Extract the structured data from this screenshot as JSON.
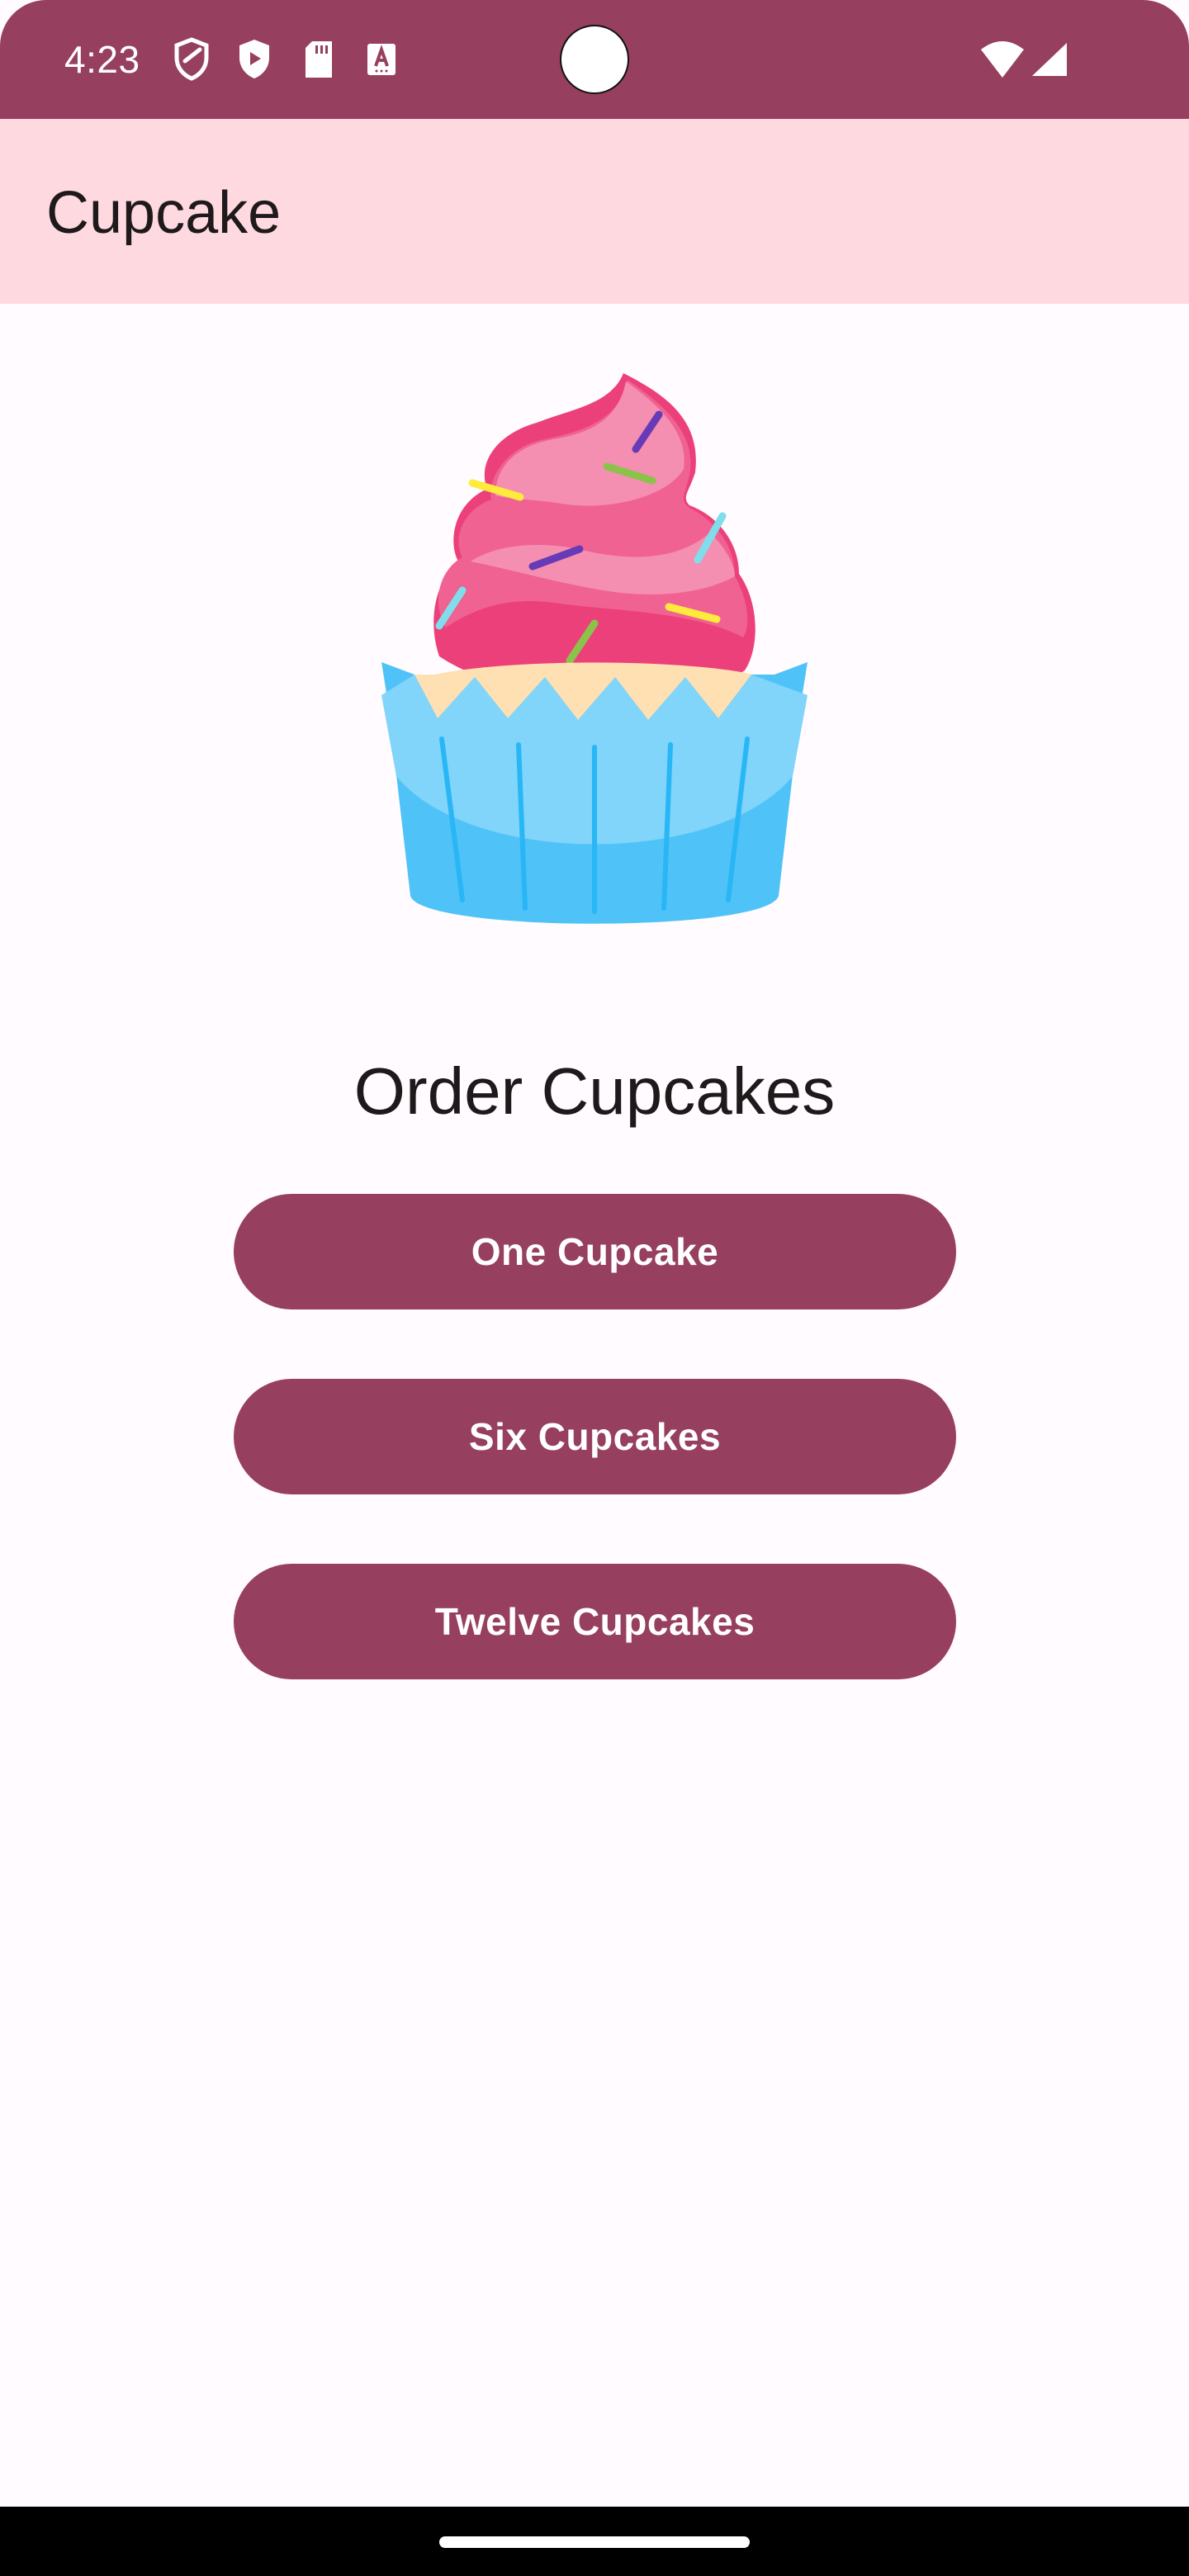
{
  "status_bar": {
    "time": "4:23",
    "icons": [
      "privacy-shield-icon",
      "play-shield-icon",
      "sd-card-icon",
      "keyboard-a-icon",
      "wifi-icon",
      "cell-signal-icon"
    ],
    "background_color": "#973F5E"
  },
  "app_bar": {
    "title": "Cupcake",
    "background_color": "#FFD9E0"
  },
  "main": {
    "illustration": "cupcake-image",
    "heading": "Order Cupcakes",
    "buttons": [
      {
        "label": "One Cupcake"
      },
      {
        "label": "Six Cupcakes"
      },
      {
        "label": "Twelve Cupcakes"
      }
    ],
    "button_color": "#973F5E"
  }
}
